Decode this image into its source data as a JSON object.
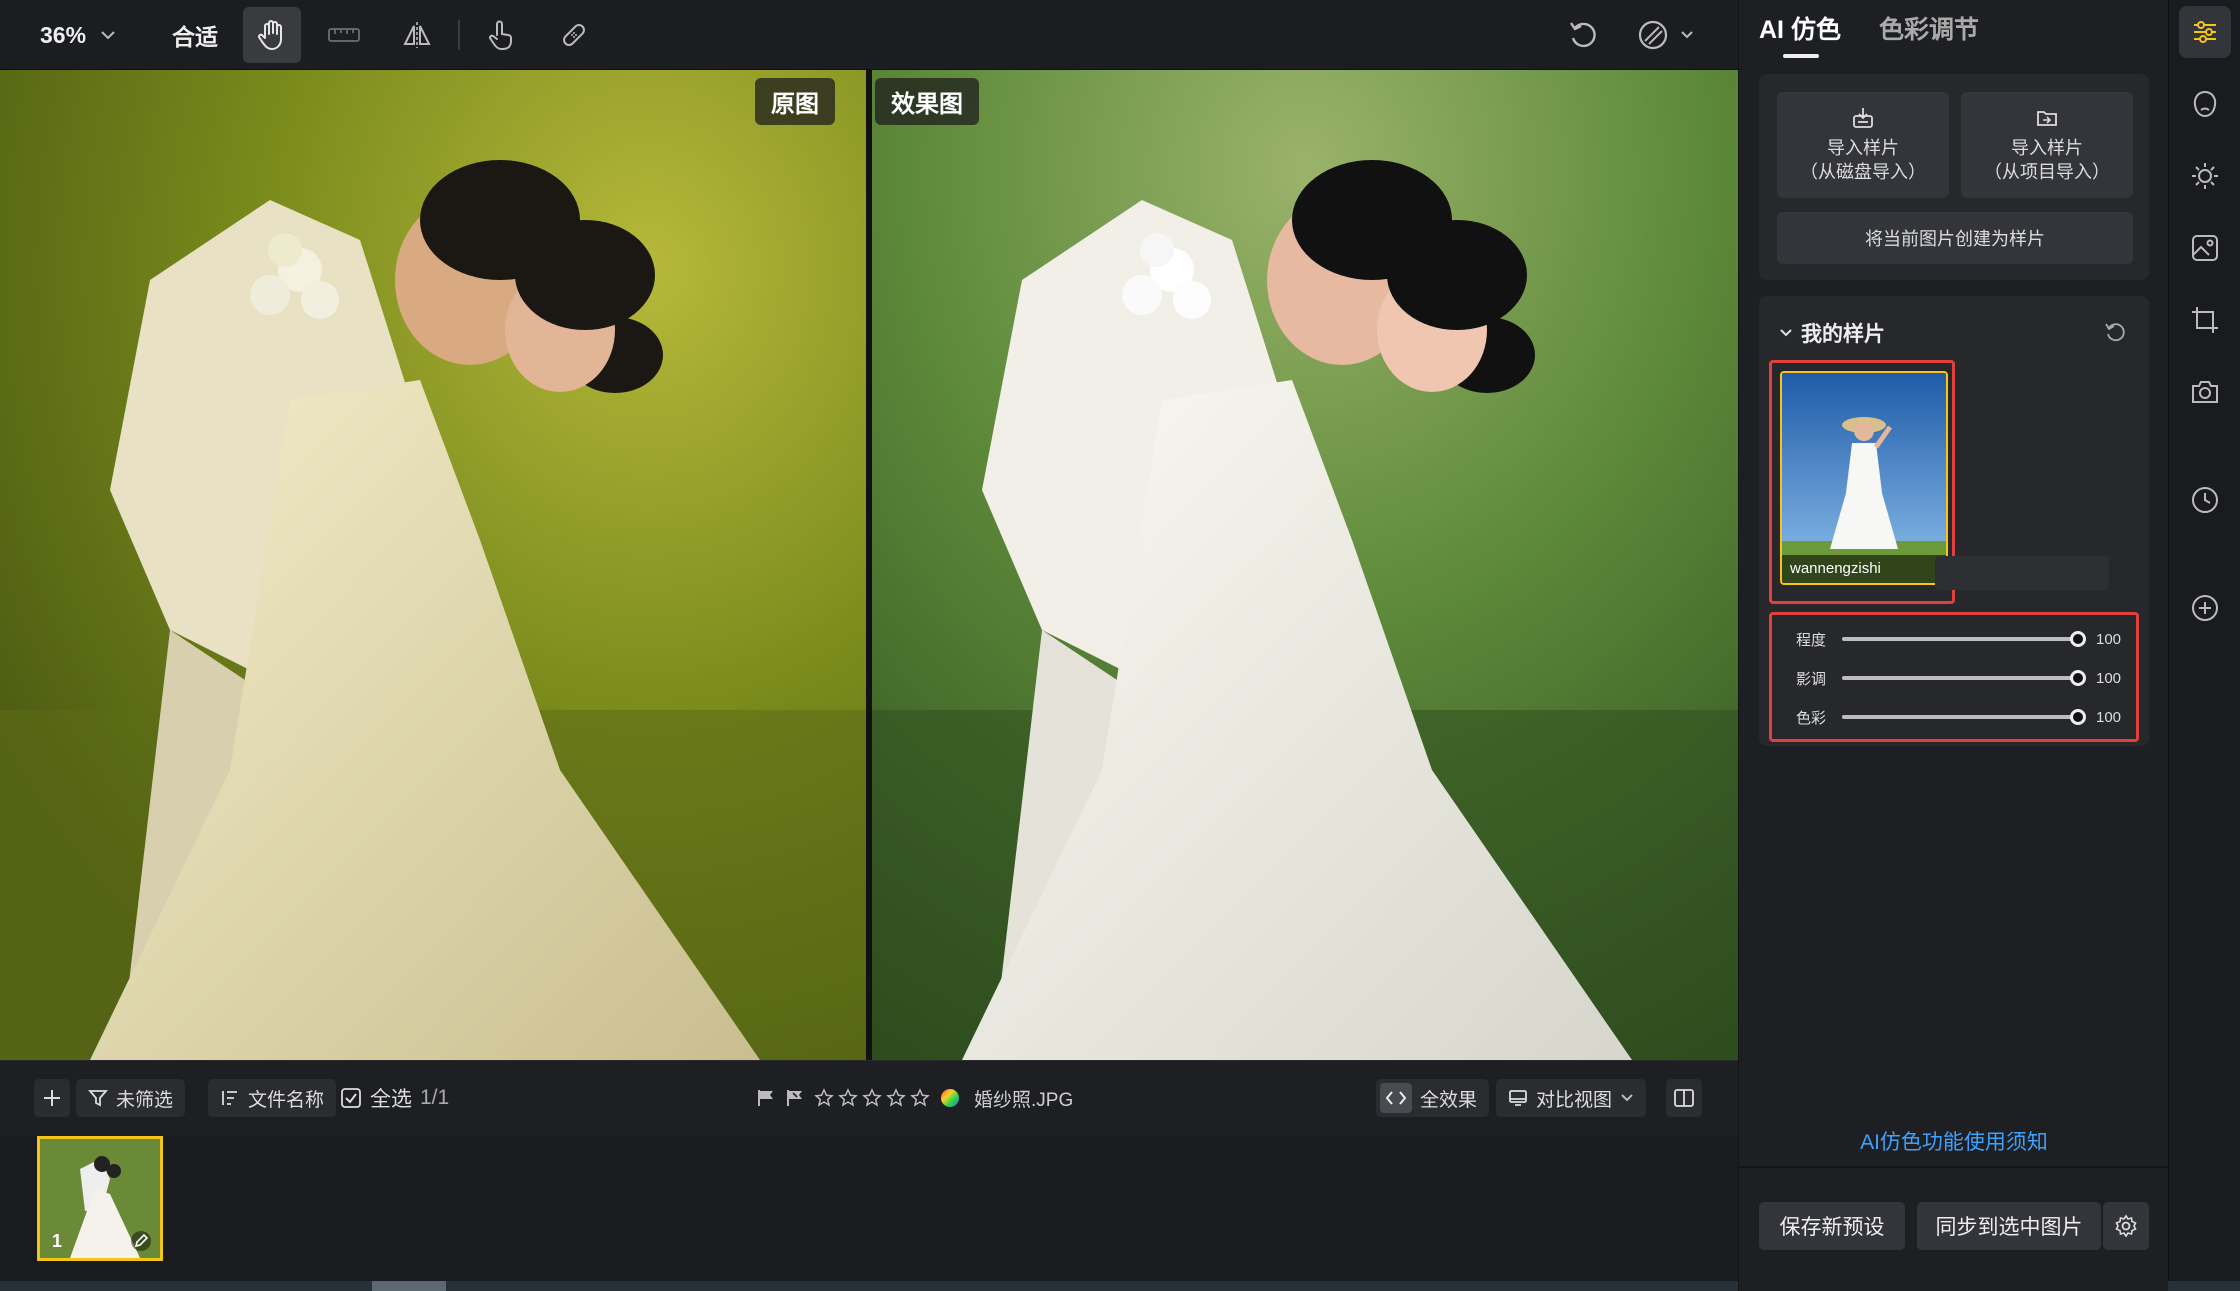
{
  "toolbar": {
    "zoom": "36%",
    "fit_label": "合适"
  },
  "canvas": {
    "original_label": "原图",
    "effect_label": "效果图"
  },
  "bottombar": {
    "unfiltered_label": "未筛选",
    "sort_label": "文件名称",
    "select_all_label": "全选",
    "count": "1/1",
    "filename": "婚纱照.JPG",
    "rating": 0,
    "full_effect_label": "全效果",
    "compare_view_label": "对比视图"
  },
  "filmstrip": {
    "thumb_index": "1"
  },
  "panel": {
    "tabs": [
      {
        "label": "AI 仿色",
        "active": true
      },
      {
        "label": "色彩调节",
        "active": false
      }
    ],
    "import_disk": {
      "line1": "导入样片",
      "line2": "（从磁盘导入）"
    },
    "import_project": {
      "line1": "导入样片",
      "line2": "（从项目导入）"
    },
    "create_sample_label": "将当前图片创建为样片",
    "my_samples_title": "我的样片",
    "sample": {
      "name": "wannengzishi"
    },
    "sliders": [
      {
        "label": "程度",
        "value": 100
      },
      {
        "label": "影调",
        "value": 100
      },
      {
        "label": "色彩",
        "value": 100
      }
    ],
    "notice_link": "AI仿色功能使用须知",
    "save_preset_label": "保存新预设",
    "sync_label": "同步到选中图片"
  },
  "colors": {
    "accent_yellow": "#f5c518",
    "highlight_red": "#e2403a",
    "link_blue": "#3ea1ff"
  }
}
